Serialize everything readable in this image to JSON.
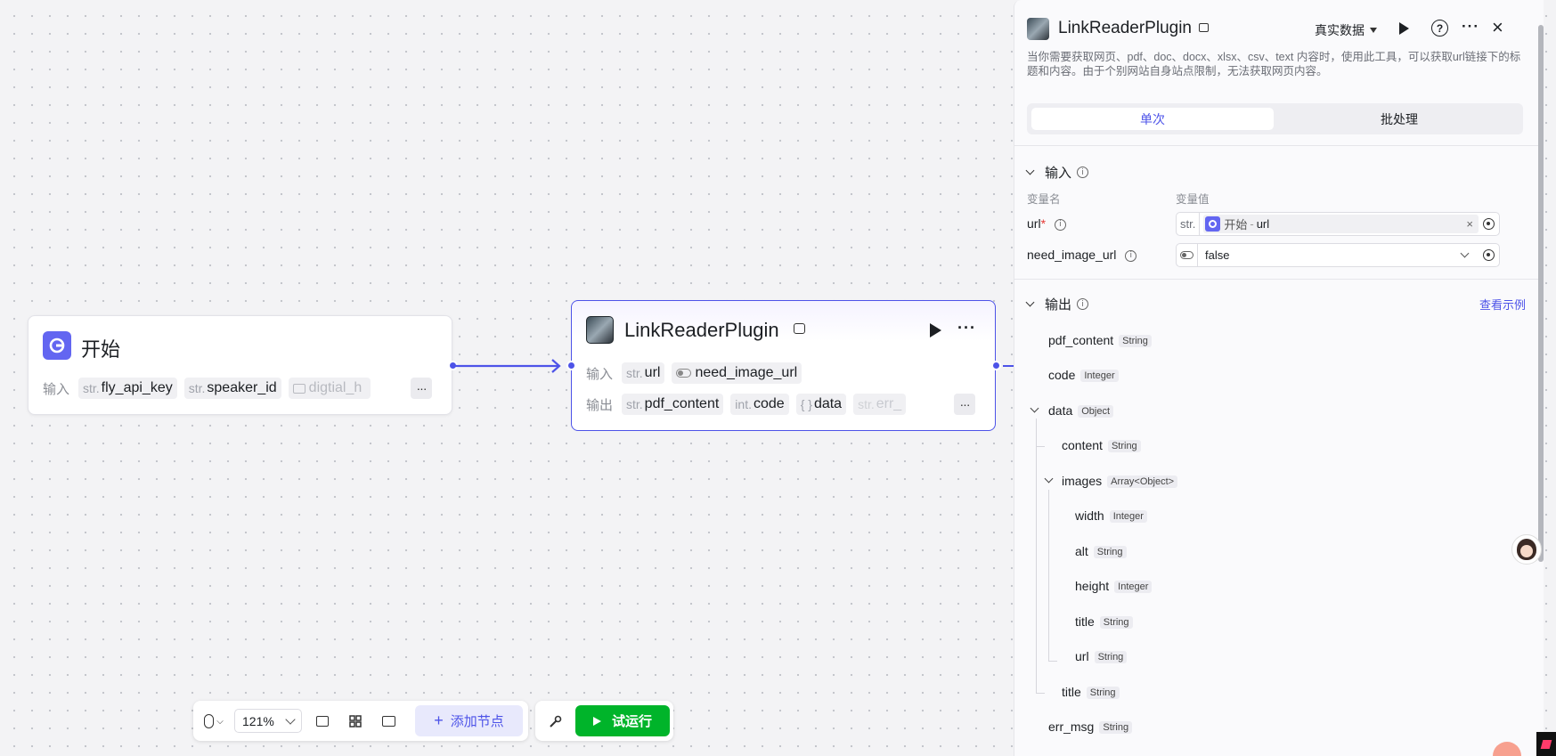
{
  "start_node": {
    "title": "开始",
    "input_label": "输入",
    "params": [
      {
        "type": "str.",
        "name": "fly_api_key"
      },
      {
        "type": "str.",
        "name": "speaker_id"
      },
      {
        "type": "",
        "name": "digtial_h"
      }
    ],
    "more": "···"
  },
  "plugin_node": {
    "title": "LinkReaderPlugin",
    "input_label": "输入",
    "output_label": "输出",
    "inputs": [
      {
        "type": "str.",
        "name": "url"
      },
      {
        "type": "",
        "name": "need_image_url"
      }
    ],
    "outputs": [
      {
        "type": "str.",
        "name": "pdf_content"
      },
      {
        "type": "int.",
        "name": "code"
      },
      {
        "type": "{ }",
        "name": "data"
      },
      {
        "type": "str.",
        "name": "err_"
      }
    ],
    "more": "···"
  },
  "panel": {
    "title": "LinkReaderPlugin",
    "data_mode": "真实数据",
    "description": "当你需要获取网页、pdf、doc、docx、xlsx、csv、text 内容时，使用此工具，可以获取url链接下的标题和内容。由于个别网站自身站点限制，无法获取网页内容。",
    "tabs": [
      "单次",
      "批处理"
    ],
    "input_section": {
      "title": "输入",
      "col_name": "变量名",
      "col_value": "变量值",
      "rows": [
        {
          "name": "url",
          "required": "*",
          "type": "str.",
          "ref_node": "开始",
          "ref_sep": "-",
          "ref_var": "url"
        },
        {
          "name": "need_image_url",
          "value": "false"
        }
      ]
    },
    "output_section": {
      "title": "输出",
      "example_link": "查看示例",
      "items": [
        {
          "name": "pdf_content",
          "type": "String"
        },
        {
          "name": "code",
          "type": "Integer"
        },
        {
          "name": "data",
          "type": "Object"
        },
        {
          "name": "content",
          "type": "String"
        },
        {
          "name": "images",
          "type": "Array<Object>"
        },
        {
          "name": "width",
          "type": "Integer"
        },
        {
          "name": "alt",
          "type": "String"
        },
        {
          "name": "height",
          "type": "Integer"
        },
        {
          "name": "title",
          "type": "String"
        },
        {
          "name": "url",
          "type": "String"
        },
        {
          "name": "title",
          "type": "String"
        },
        {
          "name": "err_msg",
          "type": "String"
        }
      ]
    }
  },
  "toolbar": {
    "zoom": "121%",
    "add_node": "添加节点",
    "test_run": "试运行"
  },
  "colors": {
    "accent": "#4d53e8",
    "run_green": "#00b42a",
    "start_icon_bg": "#6366f1"
  },
  "icons": [
    "mouse-icon",
    "comment-icon",
    "grid-icon",
    "minimap-icon",
    "plus-icon",
    "wrench-icon",
    "play-icon",
    "help-icon",
    "close-icon",
    "info-icon",
    "chevron-down-icon"
  ]
}
